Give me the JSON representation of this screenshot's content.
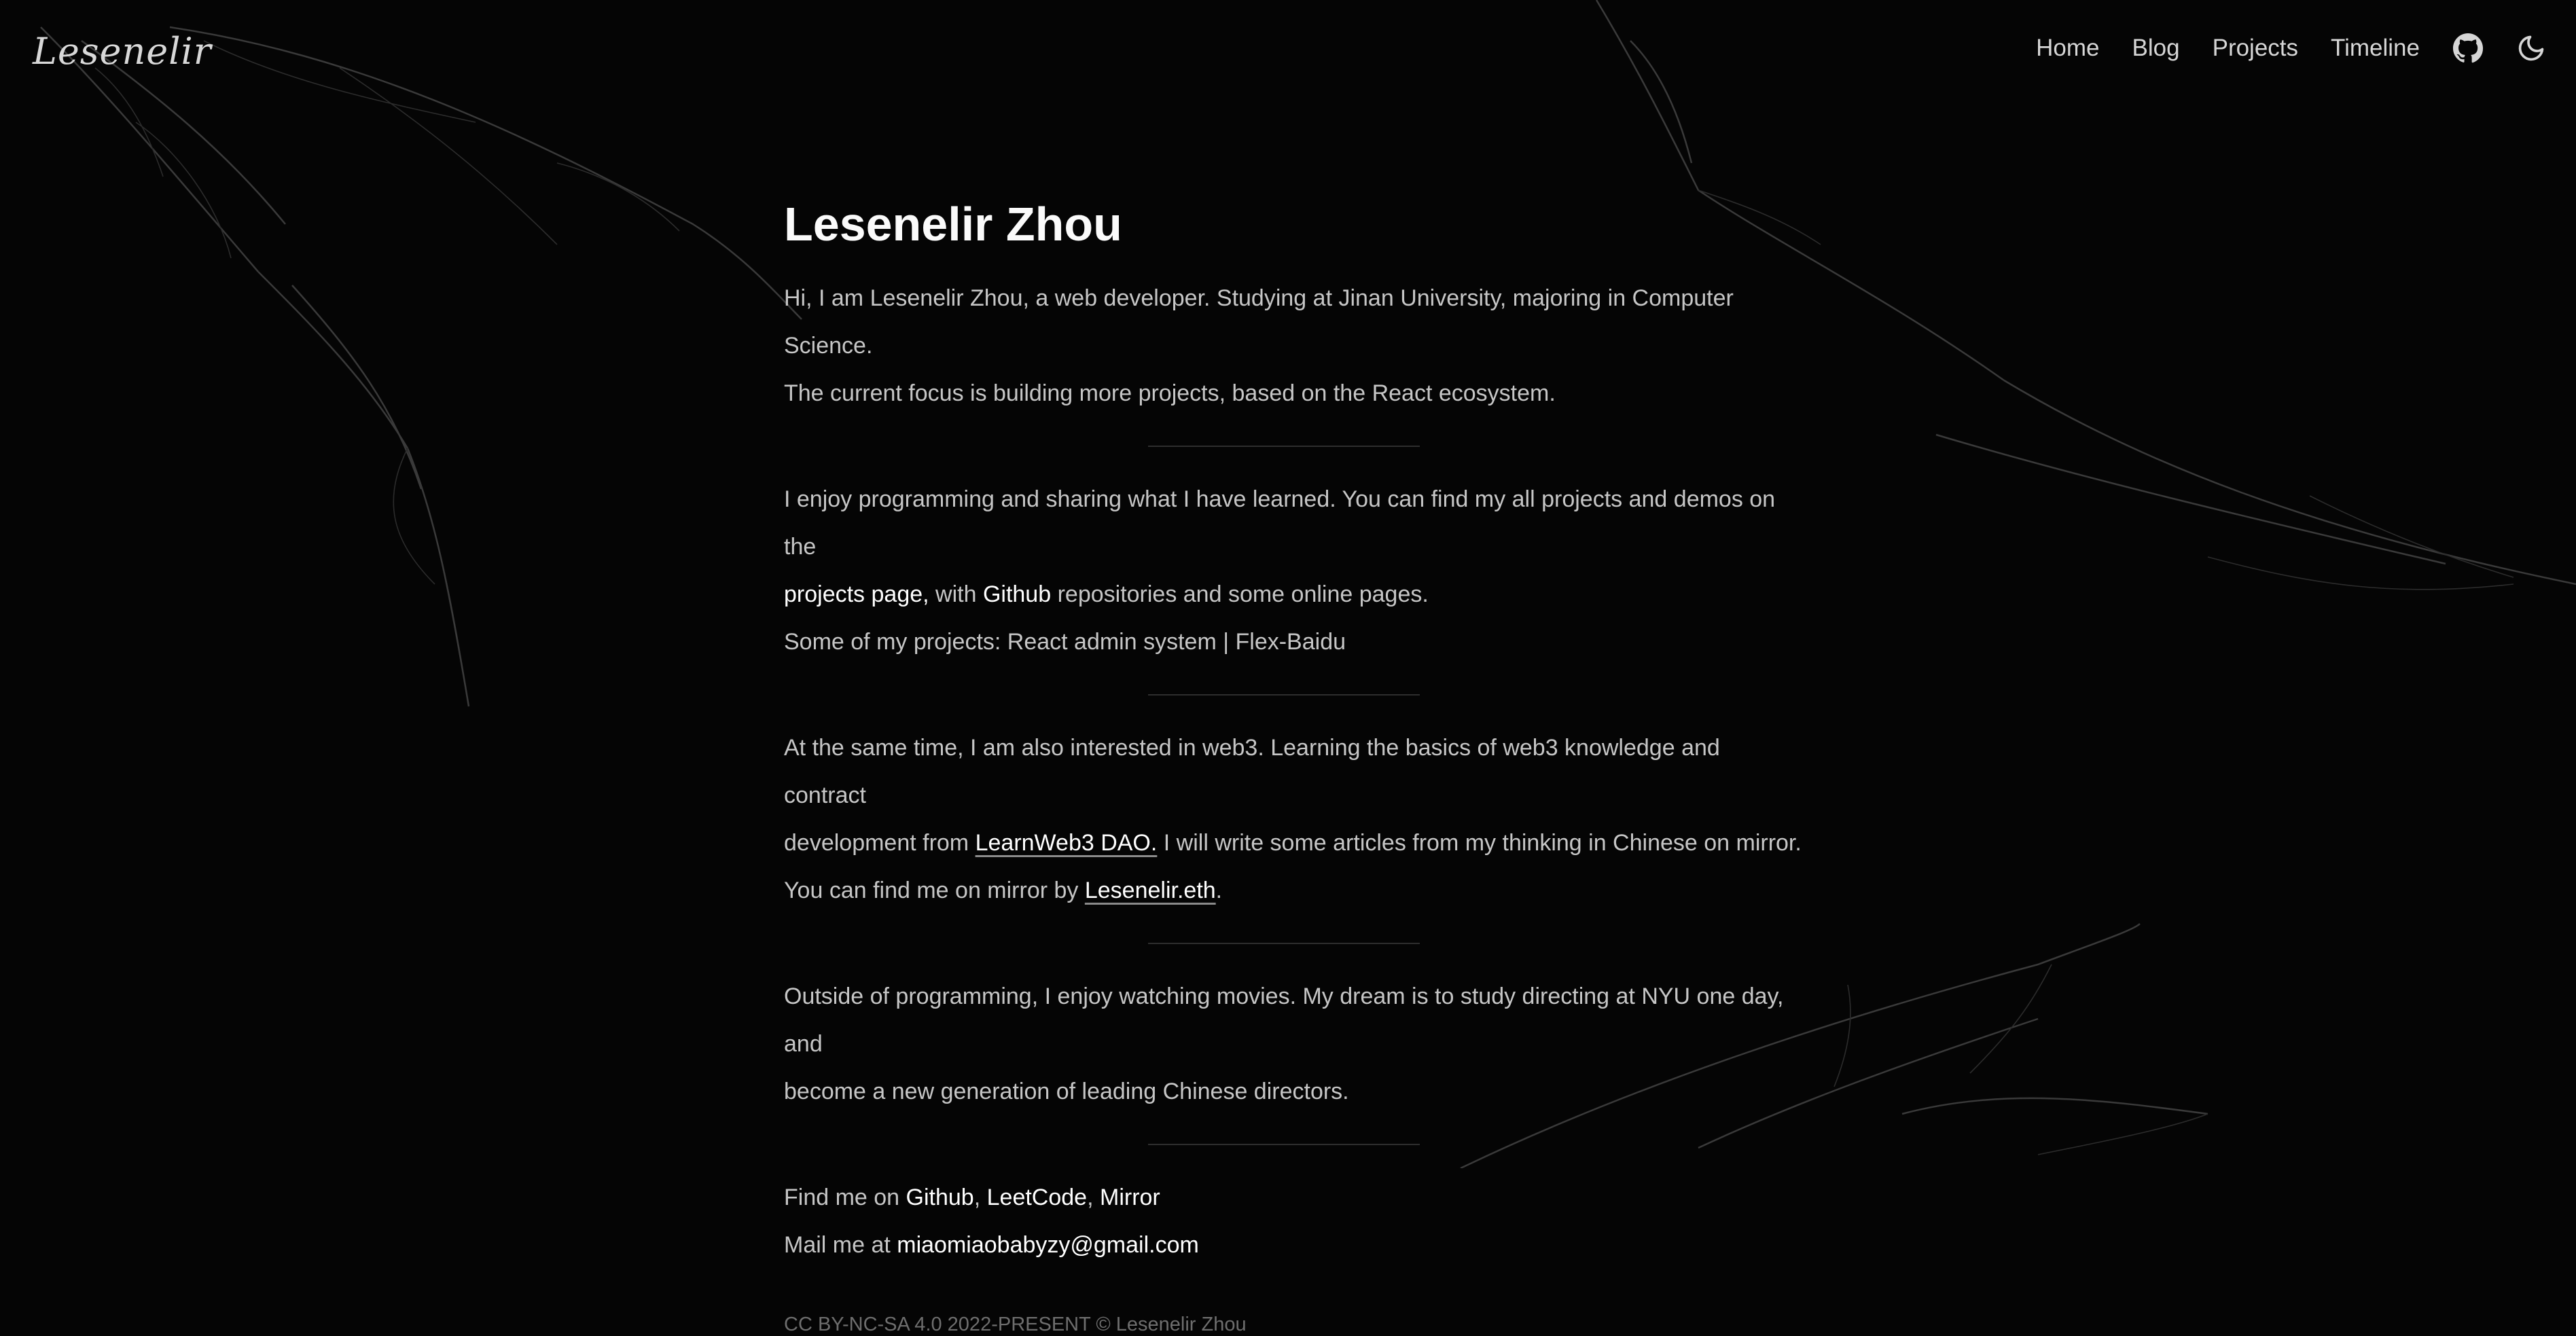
{
  "header": {
    "logo": "Lesenelir",
    "nav": [
      "Home",
      "Blog",
      "Projects",
      "Timeline"
    ],
    "icons": [
      "github-icon",
      "moon-icon"
    ]
  },
  "main": {
    "title": "Lesenelir Zhou",
    "intro": {
      "line1": "Hi, I am Lesenelir Zhou, a web developer. Studying at Jinan University, majoring in Computer Science.",
      "line2": "The current focus is building more projects, based on the React ecosystem."
    },
    "projects": {
      "line1": "I enjoy programming and sharing what I have learned. You can find my all projects and demos on the",
      "projects_link": "projects page,",
      "with": " with ",
      "github_link": "Github",
      "tail": " repositories and some online pages.",
      "line3": "Some of my projects: React admin system | Flex-Baidu"
    },
    "web3": {
      "line1": "At the same time, I am also interested in web3. Learning the basics of web3 knowledge and contract",
      "from": "development from ",
      "learnweb3_link": "LearnWeb3 DAO.",
      "mid": " I will write some articles from my thinking in Chinese on mirror.",
      "by": "You can find me on mirror by ",
      "eth_link": "Lesenelir.eth",
      "period": "."
    },
    "movies": {
      "line1": "Outside of programming, I enjoy watching movies. My dream is to study directing at NYU one day, and",
      "line2": "become a new generation of leading Chinese directors."
    },
    "contact": {
      "find": "Find me on ",
      "github": "Github",
      "comma": ", ",
      "leetcode": "LeetCode",
      "mirror": "Mirror",
      "mail": "Mail me at ",
      "email": "miaomiaobabyzy@gmail.com"
    },
    "footer": "CC BY-NC-SA 4.0 2022-PRESENT © Lesenelir Zhou"
  },
  "colors": {
    "background": "#050505",
    "text": "#c6c6c6",
    "heading": "#fafafa",
    "link": "#ffffff"
  }
}
